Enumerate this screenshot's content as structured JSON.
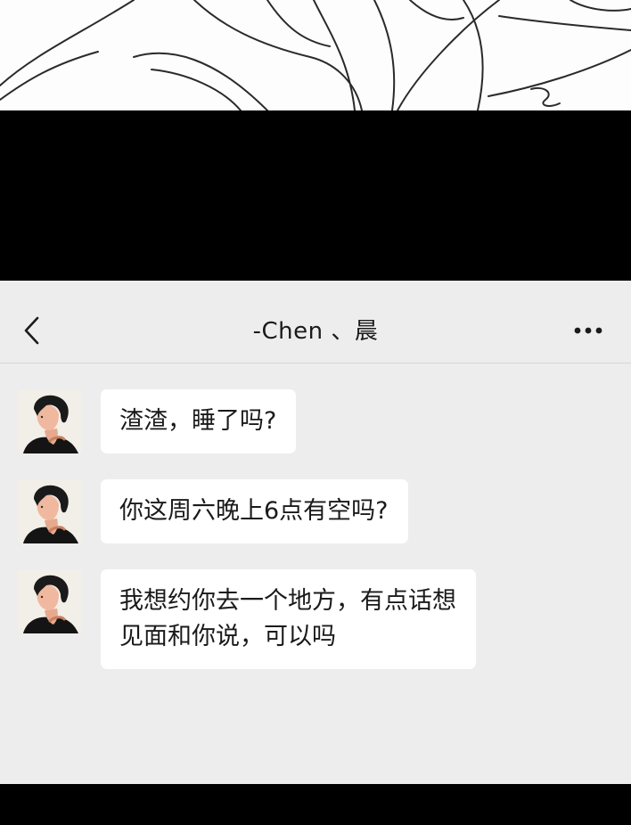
{
  "header": {
    "title": "-Chen 、晨",
    "back_icon": "chevron-left-icon",
    "more_icon": "ellipsis-icon"
  },
  "messages": [
    {
      "sender_avatar": "contact-avatar",
      "text": "渣渣，睡了吗?"
    },
    {
      "sender_avatar": "contact-avatar",
      "text": "你这周六晚上6点有空吗?"
    },
    {
      "sender_avatar": "contact-avatar",
      "text": "我想约你去一个地方，有点话想\n见面和你说，可以吗"
    }
  ],
  "colors": {
    "chat_background": "#ededed",
    "bubble": "#ffffff",
    "text": "#1a1a1a",
    "band": "#000000"
  }
}
